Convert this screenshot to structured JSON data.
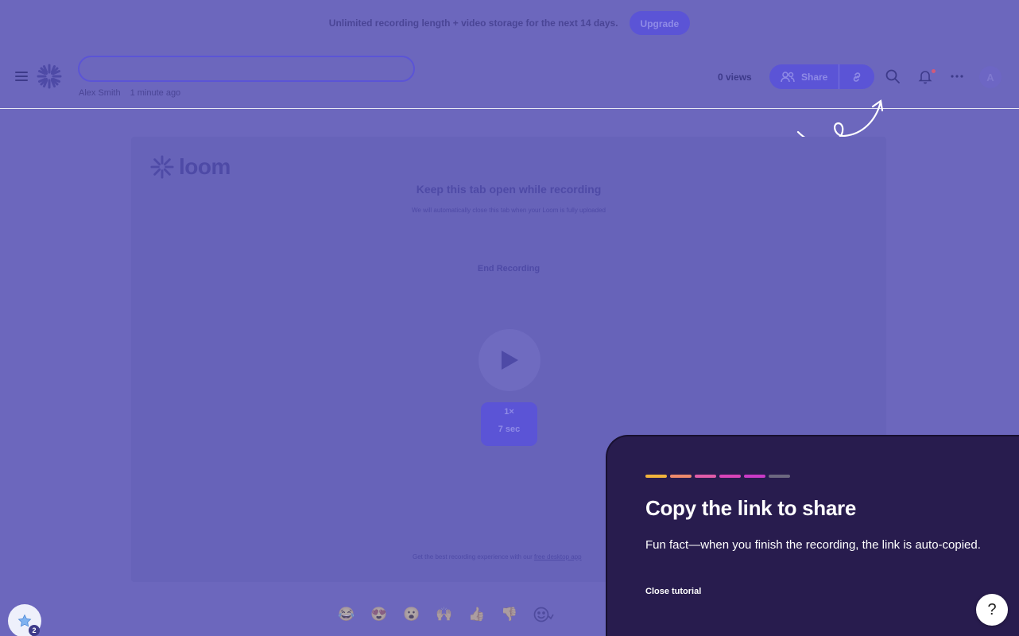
{
  "banner": {
    "text": "Unlimited recording length + video storage for the next 14 days.",
    "upgrade_label": "Upgrade"
  },
  "header": {
    "title_value": "",
    "author": "Alex Smith",
    "time_ago": "1 minute ago",
    "views": "0 views",
    "share_label": "Share",
    "avatar_initial": "A"
  },
  "panel": {
    "logo_text": "loom",
    "title": "Keep this tab open while recording",
    "subtitle": "We will automatically close this tab when your Loom is fully uploaded",
    "end_recording_label": "End Recording",
    "speed": "1×",
    "duration": "7 sec",
    "footer_prefix": "Get the best recording experience with our ",
    "footer_link": "free desktop app"
  },
  "reactions": [
    "😂",
    "😍",
    "😮",
    "🙌",
    "👍",
    "👎"
  ],
  "tutorial": {
    "title": "Copy the link to share",
    "body": "Fun fact—when you finish the recording, the link is auto-copied.",
    "close_label": "Close tutorial",
    "progress_colors": [
      "#f1b33c",
      "#ee8a6c",
      "#e05ca8",
      "#d844b8",
      "#c93bc6",
      "#6c6880"
    ]
  },
  "help_label": "?",
  "badge_count": "2"
}
